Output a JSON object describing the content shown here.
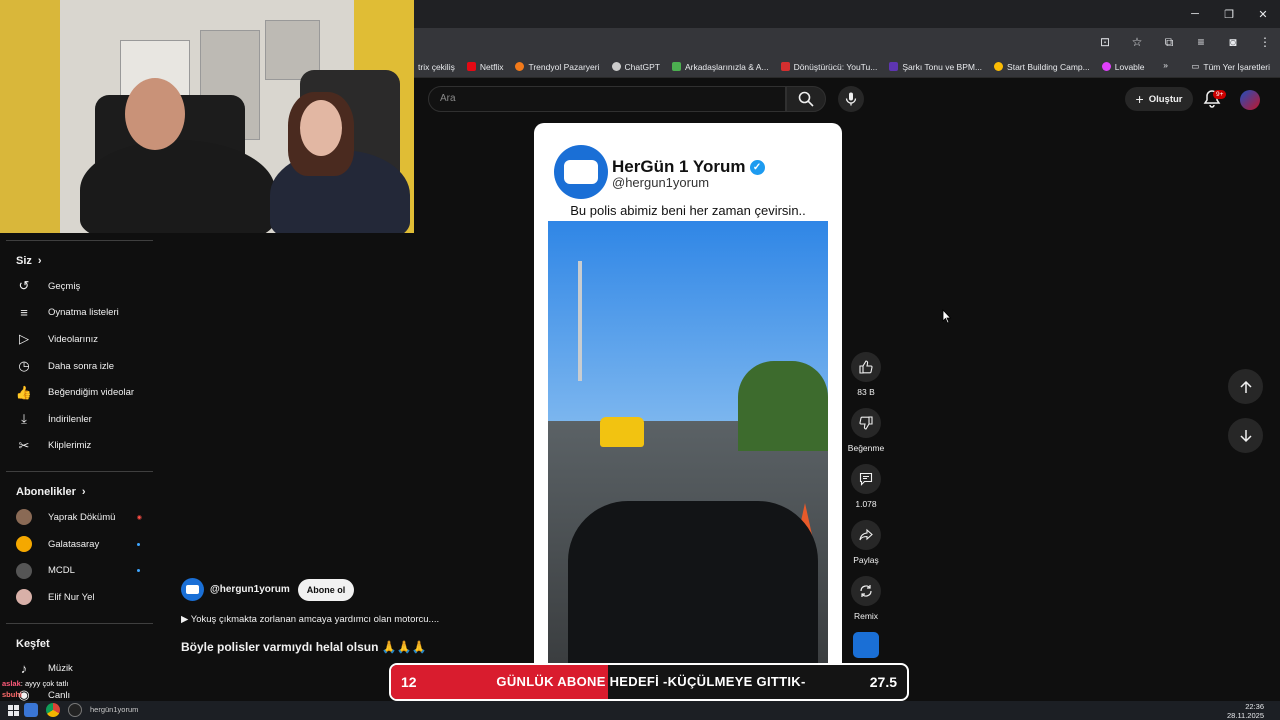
{
  "browser": {
    "window_controls": [
      "─",
      "❐",
      "✕"
    ],
    "bookmarks": [
      {
        "label": "trix çekiliş",
        "color": "#888888"
      },
      {
        "label": "Netflix",
        "color": "#e50914"
      },
      {
        "label": "Trendyol Pazaryeri",
        "color": "#f27a1a"
      },
      {
        "label": "ChatGPT",
        "color": "#cccccc"
      },
      {
        "label": "Arkadaşlarınızla & A...",
        "color": "#4caf50"
      },
      {
        "label": "Dönüştürücü: YouTu...",
        "color": "#d32f2f"
      },
      {
        "label": "Şarkı Tonu ve BPM...",
        "color": "#5e35b1"
      },
      {
        "label": "Start Building Camp...",
        "color": "#fbbc04"
      },
      {
        "label": "Lovable",
        "color": "#e040fb"
      }
    ],
    "bookmarks_more": "»",
    "all_bookmarks": "Tüm Yer İşaretleri"
  },
  "sidebar": {
    "you_section": "Siz",
    "you_items": [
      {
        "label": "Geçmiş",
        "icon": "history-icon",
        "glyph": "↺"
      },
      {
        "label": "Oynatma listeleri",
        "icon": "playlist-icon",
        "glyph": "≡"
      },
      {
        "label": "Videolarınız",
        "icon": "video-icon",
        "glyph": "▷"
      },
      {
        "label": "Daha sonra izle",
        "icon": "clock-icon",
        "glyph": "◷"
      },
      {
        "label": "Beğendiğim videolar",
        "icon": "like-icon",
        "glyph": "👍"
      },
      {
        "label": "İndirilenler",
        "icon": "download-icon",
        "glyph": "⤓"
      },
      {
        "label": "Kliplerimiz",
        "icon": "scissors-icon",
        "glyph": "✂"
      }
    ],
    "subs_section": "Abonelikler",
    "subs_items": [
      {
        "label": "Yaprak Dökümü",
        "color": "#8a6a55",
        "status": "live"
      },
      {
        "label": "Galatasaray",
        "color": "#f5a800",
        "status": "dot"
      },
      {
        "label": "MCDL",
        "color": "#555555",
        "status": "dot"
      },
      {
        "label": "Elif Nur Yel",
        "color": "#d8b0a8",
        "status": "none"
      }
    ],
    "explore_section": "Keşfet",
    "explore_items": [
      {
        "label": "Müzik",
        "icon": "music-icon",
        "glyph": "♪"
      },
      {
        "label": "Canlı",
        "icon": "live-icon",
        "glyph": "◉"
      }
    ]
  },
  "header": {
    "search_placeholder": "Ara",
    "create_label": "Oluştur",
    "notification_badge": "9+"
  },
  "short": {
    "post_name": "HerGün 1 Yorum",
    "post_handle": "@hergun1yorum",
    "post_caption": "Bu polis abimiz beni her zaman çevirsin..",
    "like_count": "83 B",
    "dislike_label": "Beğenme",
    "comment_count": "1.078",
    "share_label": "Paylaş",
    "remix_label": "Remix",
    "channel": "@hergun1yorum",
    "subscribe_label": "Abone ol",
    "description": "▶ Yokuş çıkmakta zorlanan amcaya yardımcı olan motorcu....",
    "title": "Böyle polisler varmıydı helal olsun 🙏🙏🙏"
  },
  "overlay": {
    "goal_current": "12",
    "goal_text": "GÜNLÜK ABONE HEDEFİ -KÜÇÜLMEYE GITTIK-",
    "goal_target": "27.5",
    "goal_progress": 0.42,
    "chat_user": "aslak",
    "chat_message": ": ayyy çok tatlı",
    "chat_user2": "sbuhi"
  },
  "taskbar": {
    "yt_label": "hergün1yorum",
    "time": "22:36",
    "date": "28.11.2025"
  }
}
